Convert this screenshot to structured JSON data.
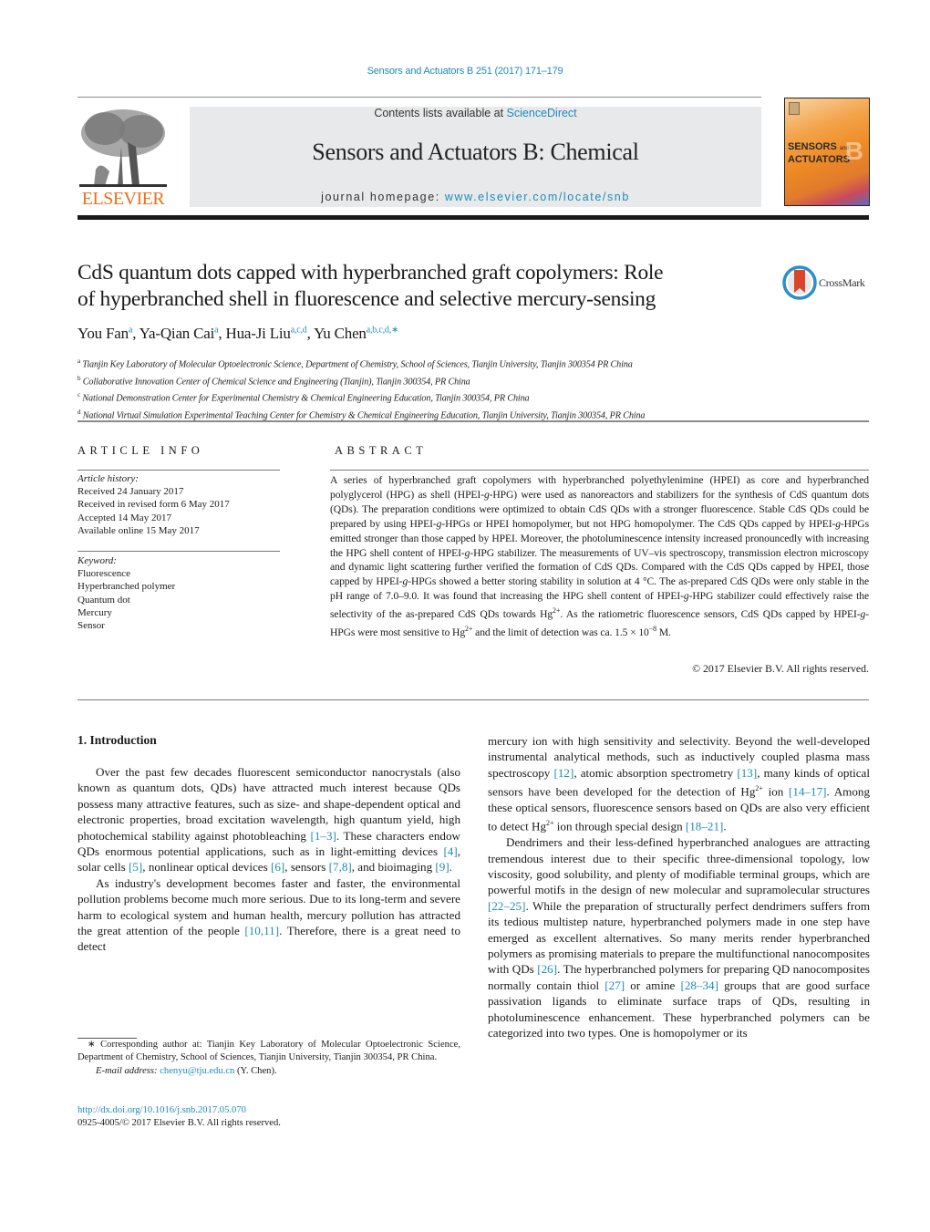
{
  "header": {
    "journal_ref": "Sensors and Actuators B 251 (2017) 171–179",
    "contents_prefix": "Contents lists available at ",
    "contents_link": "ScienceDirect",
    "journal_title": "Sensors and Actuators B: Chemical",
    "homepage_prefix": "journal homepage: ",
    "homepage_link": "www.elsevier.com/locate/snb",
    "publisher_logo_text": "ELSEVIER",
    "cover_text_line1": "SENSORS",
    "cover_text_and": "and",
    "cover_text_line2": "ACTUATORS",
    "cover_letter": "B",
    "accent_color": "#1e8bb8",
    "publisher_color": "#e9711c"
  },
  "article": {
    "title_line1": "CdS quantum dots capped with hyperbranched graft copolymers: Role",
    "title_line2": "of hyperbranched shell in fluorescence and selective mercury-sensing",
    "crossmark_label": "CrossMark",
    "authors": [
      {
        "name": "You Fan",
        "sup": "a"
      },
      {
        "name": "Ya-Qian Cai",
        "sup": "a"
      },
      {
        "name": "Hua-Ji Liu",
        "sup": "a,c,d"
      },
      {
        "name": "Yu Chen",
        "sup": "a,b,c,d,∗"
      }
    ],
    "affiliations": [
      {
        "key": "a",
        "text": "Tianjin Key Laboratory of Molecular Optoelectronic Science, Department of Chemistry, School of Sciences, Tianjin University, Tianjin 300354 PR China"
      },
      {
        "key": "b",
        "text": "Collaborative Innovation Center of Chemical Science and Engineering (Tianjin), Tianjin 300354, PR China"
      },
      {
        "key": "c",
        "text": "National Demonstration Center for Experimental Chemistry & Chemical Engineering Education, Tianjin 300354, PR China"
      },
      {
        "key": "d",
        "text": "National Virtual Simulation Experimental Teaching Center for Chemistry & Chemical Engineering Education, Tianjin University, Tianjin 300354, PR China"
      }
    ]
  },
  "article_info": {
    "heading": "ARTICLE INFO",
    "history_label": "Article history:",
    "history": [
      "Received 24 January 2017",
      "Received in revised form 6 May 2017",
      "Accepted 14 May 2017",
      "Available online 15 May 2017"
    ],
    "keyword_label": "Keyword:",
    "keywords": [
      "Fluorescence",
      "Hyperbranched polymer",
      "Quantum dot",
      "Mercury",
      "Sensor"
    ]
  },
  "abstract": {
    "heading": "ABSTRACT",
    "s1": "A series of hyperbranched graft copolymers with hyperbranched polyethylenimine (HPEI) as core and hyperbranched polyglycerol (HPG) as shell (HPEI-",
    "g1": "g",
    "s2": "-HPG) were used as nanoreactors and stabilizers for the synthesis of CdS quantum dots (QDs). The preparation conditions were optimized to obtain CdS QDs with a stronger fluorescence. Stable CdS QDs could be prepared by using HPEI-",
    "g2": "g",
    "s3": "-HPGs or HPEI homopolymer, but not HPG homopolymer. The CdS QDs capped by HPEI-",
    "g3": "g",
    "s4": "-HPGs emitted stronger than those capped by HPEI. Moreover, the photoluminescence intensity increased pronouncedly with increasing the HPG shell content of HPEI-",
    "g4": "g",
    "s5": "-HPG stabilizer. The measurements of UV–vis spectroscopy, transmission electron microscopy and dynamic light scattering further verified the formation of CdS QDs. Compared with the CdS QDs capped by HPEI, those capped by HPEI-",
    "g5": "g",
    "s6": "-HPGs showed a better storing stability in solution at 4 °C. The as-prepared CdS QDs were only stable in the pH range of 7.0–9.0. It was found that increasing the HPG shell content of HPEI-",
    "g6": "g",
    "s7": "-HPG stabilizer could effectively raise the selectivity of the as-prepared CdS QDs towards Hg",
    "sup1": "2+",
    "s8": ". As the ratiometric fluorescence sensors, CdS QDs capped by HPEI-",
    "g7": "g",
    "s9": "-HPGs were most sensitive to Hg",
    "sup2": "2+",
    "s10": " and the limit of detection was ca. 1.5 × 10",
    "sup3": "−8",
    "s11": " M.",
    "copyright": "© 2017 Elsevier B.V. All rights reserved."
  },
  "body": {
    "section_heading": "1.  Introduction",
    "left": {
      "p1a": "Over the past few decades fluorescent semiconductor nanocrystals (also known as quantum dots, QDs) have attracted much interest because QDs possess many attractive features, such as size- and shape-dependent optical and electronic properties, broad excitation wavelength, high quantum yield, high photochemical stability against photobleaching ",
      "ref1": "[1–3]",
      "p1b": ". These characters endow QDs enormous potential applications, such as in light-emitting devices ",
      "ref2": "[4]",
      "p1c": ", solar cells ",
      "ref3": "[5]",
      "p1d": ", nonlinear optical devices ",
      "ref4": "[6]",
      "p1e": ", sensors ",
      "ref5": "[7,8]",
      "p1f": ", and bioimaging ",
      "ref6": "[9]",
      "p1g": ".",
      "p2a": "As industry's development becomes faster and faster, the environmental pollution problems become much more serious. Due to its long-term and severe harm to ecological system and human health, mercury pollution has attracted the great attention of the people ",
      "ref7": "[10,11]",
      "p2b": ". Therefore, there is a great need to detect"
    },
    "right": {
      "p1a": "mercury ion with high sensitivity and selectivity. Beyond the well-developed instrumental analytical methods, such as inductively coupled plasma mass spectroscopy ",
      "ref1": "[12]",
      "p1b": ", atomic absorption spectrometry ",
      "ref2": "[13]",
      "p1c": ", many kinds of optical sensors have been developed for the detection of Hg",
      "sup1": "2+",
      "p1d": " ion ",
      "ref3": "[14–17]",
      "p1e": ". Among these optical sensors, fluorescence sensors based on QDs are also very efficient to detect Hg",
      "sup2": "2+",
      "p1f": " ion through special design ",
      "ref4": "[18–21]",
      "p1g": ".",
      "p2a": "Dendrimers and their less-defined hyperbranched analogues are attracting tremendous interest due to their specific three-dimensional topology, low viscosity, good solubility, and plenty of modifiable terminal groups, which are powerful motifs in the design of new molecular and supramolecular structures ",
      "ref5": "[22–25]",
      "p2b": ". While the preparation of structurally perfect dendrimers suffers from its tedious multistep nature, hyperbranched polymers made in one step have emerged as excellent alternatives. So many merits render hyperbranched polymers as promising materials to prepare the multifunctional nanocomposites with QDs ",
      "ref6": "[26]",
      "p2c": ". The hyperbranched polymers for preparing QD nanocomposites normally contain thiol ",
      "ref7": "[27]",
      "p2d": " or amine ",
      "ref8": "[28–34]",
      "p2e": " groups that are good surface passivation ligands to eliminate surface traps of QDs, resulting in photoluminescence enhancement. These hyperbranched polymers can be categorized into two types. One is homopolymer or its"
    }
  },
  "footnote": {
    "star": "∗",
    "corresponding": " Corresponding author at: Tianjin Key Laboratory of Molecular Optoelectronic Science, Department of Chemistry, School of Sciences, Tianjin University, Tianjin 300354, PR China.",
    "email_label": "E-mail address: ",
    "email": "chenyu@tju.edu.cn",
    "email_suffix": " (Y. Chen).",
    "doi": "http://dx.doi.org/10.1016/j.snb.2017.05.070",
    "issn": "0925-4005/© 2017 Elsevier B.V. All rights reserved."
  }
}
